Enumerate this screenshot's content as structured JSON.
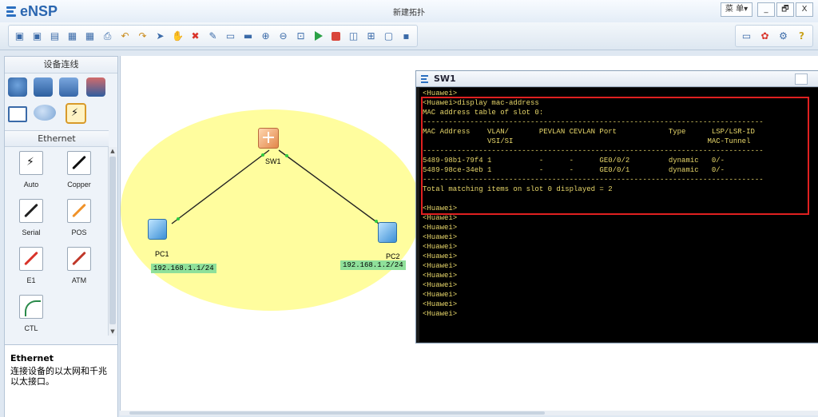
{
  "app": {
    "name": "eNSP",
    "window_title": "新建拓扑",
    "menu_label": "菜 单▾",
    "window_buttons": [
      "_",
      "🗗",
      "X"
    ]
  },
  "toolbar": {
    "left_icons": [
      "new-topology-icon",
      "new-lab-icon",
      "open-icon",
      "save-icon",
      "save-as-icon",
      "print-icon",
      "undo-icon",
      "redo-icon",
      "select-icon",
      "pan-icon",
      "delete-icon",
      "delete-links-icon",
      "text-icon",
      "rectangle-icon",
      "zoom-in-icon",
      "zoom-out-icon",
      "fit-icon",
      "start-icon",
      "stop-icon",
      "capture-icon",
      "topology-icon",
      "window-icon",
      "console-icon"
    ],
    "right_icons": [
      "chat-icon",
      "huawei-icon",
      "settings-icon",
      "help-icon"
    ]
  },
  "left_panel": {
    "header": "设备连线",
    "section": "Ethernet",
    "cables": [
      {
        "label": "Auto",
        "color": "#111111"
      },
      {
        "label": "Copper",
        "color": "#111111"
      },
      {
        "label": "Serial",
        "color": "#222222"
      },
      {
        "label": "POS",
        "color": "#f0932b"
      },
      {
        "label": "E1",
        "color": "#d9342b"
      },
      {
        "label": "ATM",
        "color": "#c0392b"
      },
      {
        "label": "CTL",
        "color": "#2a8a4a"
      }
    ],
    "description_title": "Ethernet",
    "description_text": "连接设备的以太网和千兆以太接口。"
  },
  "topology": {
    "switch": {
      "label": "SW1"
    },
    "pc1": {
      "label": "PC1",
      "ip": "192.168.1.1/24"
    },
    "pc2": {
      "label": "PC2",
      "ip": "192.168.1.2/24"
    }
  },
  "terminal": {
    "title": "SW1",
    "lines": [
      "<Huawei>",
      "<Huawei>display mac-address",
      "MAC address table of slot 0:",
      "-------------------------------------------------------------------------------",
      "MAC Address    VLAN/       PEVLAN CEVLAN Port            Type      LSP/LSR-ID",
      "               VSI/SI                                             MAC-Tunnel",
      "-------------------------------------------------------------------------------",
      "5489-98b1-79f4 1           -      -      GE0/0/2         dynamic   0/-",
      "5489-98ce-34eb 1           -      -      GE0/0/1         dynamic   0/-",
      "-------------------------------------------------------------------------------",
      "Total matching items on slot 0 displayed = 2",
      "",
      "<Huawei>",
      "<Huawei>",
      "<Huawei>",
      "<Huawei>",
      "<Huawei>",
      "<Huawei>",
      "<Huawei>",
      "<Huawei>",
      "<Huawei>",
      "<Huawei>",
      "<Huawei>",
      "<Huawei>"
    ]
  }
}
